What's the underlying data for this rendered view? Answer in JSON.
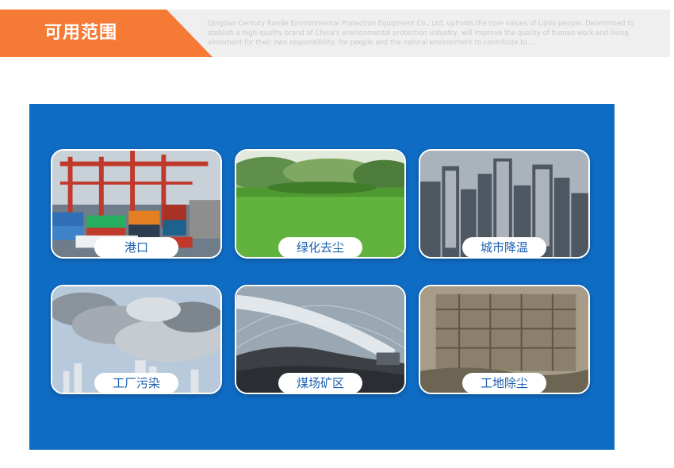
{
  "header": {
    "title": "可用范围",
    "intro": "Qingdao Century Runde Environmental Protection Equipment Co., Ltd. upholds the core values of Lijida people. Determined to stablish a high-quality brand of China's environmental protection industry, will improve the quality of human work and living vironment for their own responsibility, for people and the natural environment to contribute to ..."
  },
  "cards": [
    {
      "label": "港口",
      "image": "port-container-cranes"
    },
    {
      "label": "绿化去尘",
      "image": "green-lawn"
    },
    {
      "label": "城市降温",
      "image": "city-skyline"
    },
    {
      "label": "工厂污染",
      "image": "factory-smoke"
    },
    {
      "label": "煤场矿区",
      "image": "coal-yard-mist-cannon"
    },
    {
      "label": "工地除尘",
      "image": "construction-site"
    }
  ],
  "colors": {
    "accent_orange": "#f47a35",
    "panel_blue": "#0f6cc4",
    "label_text": "#1a5fb0",
    "header_gray": "#efefef"
  }
}
